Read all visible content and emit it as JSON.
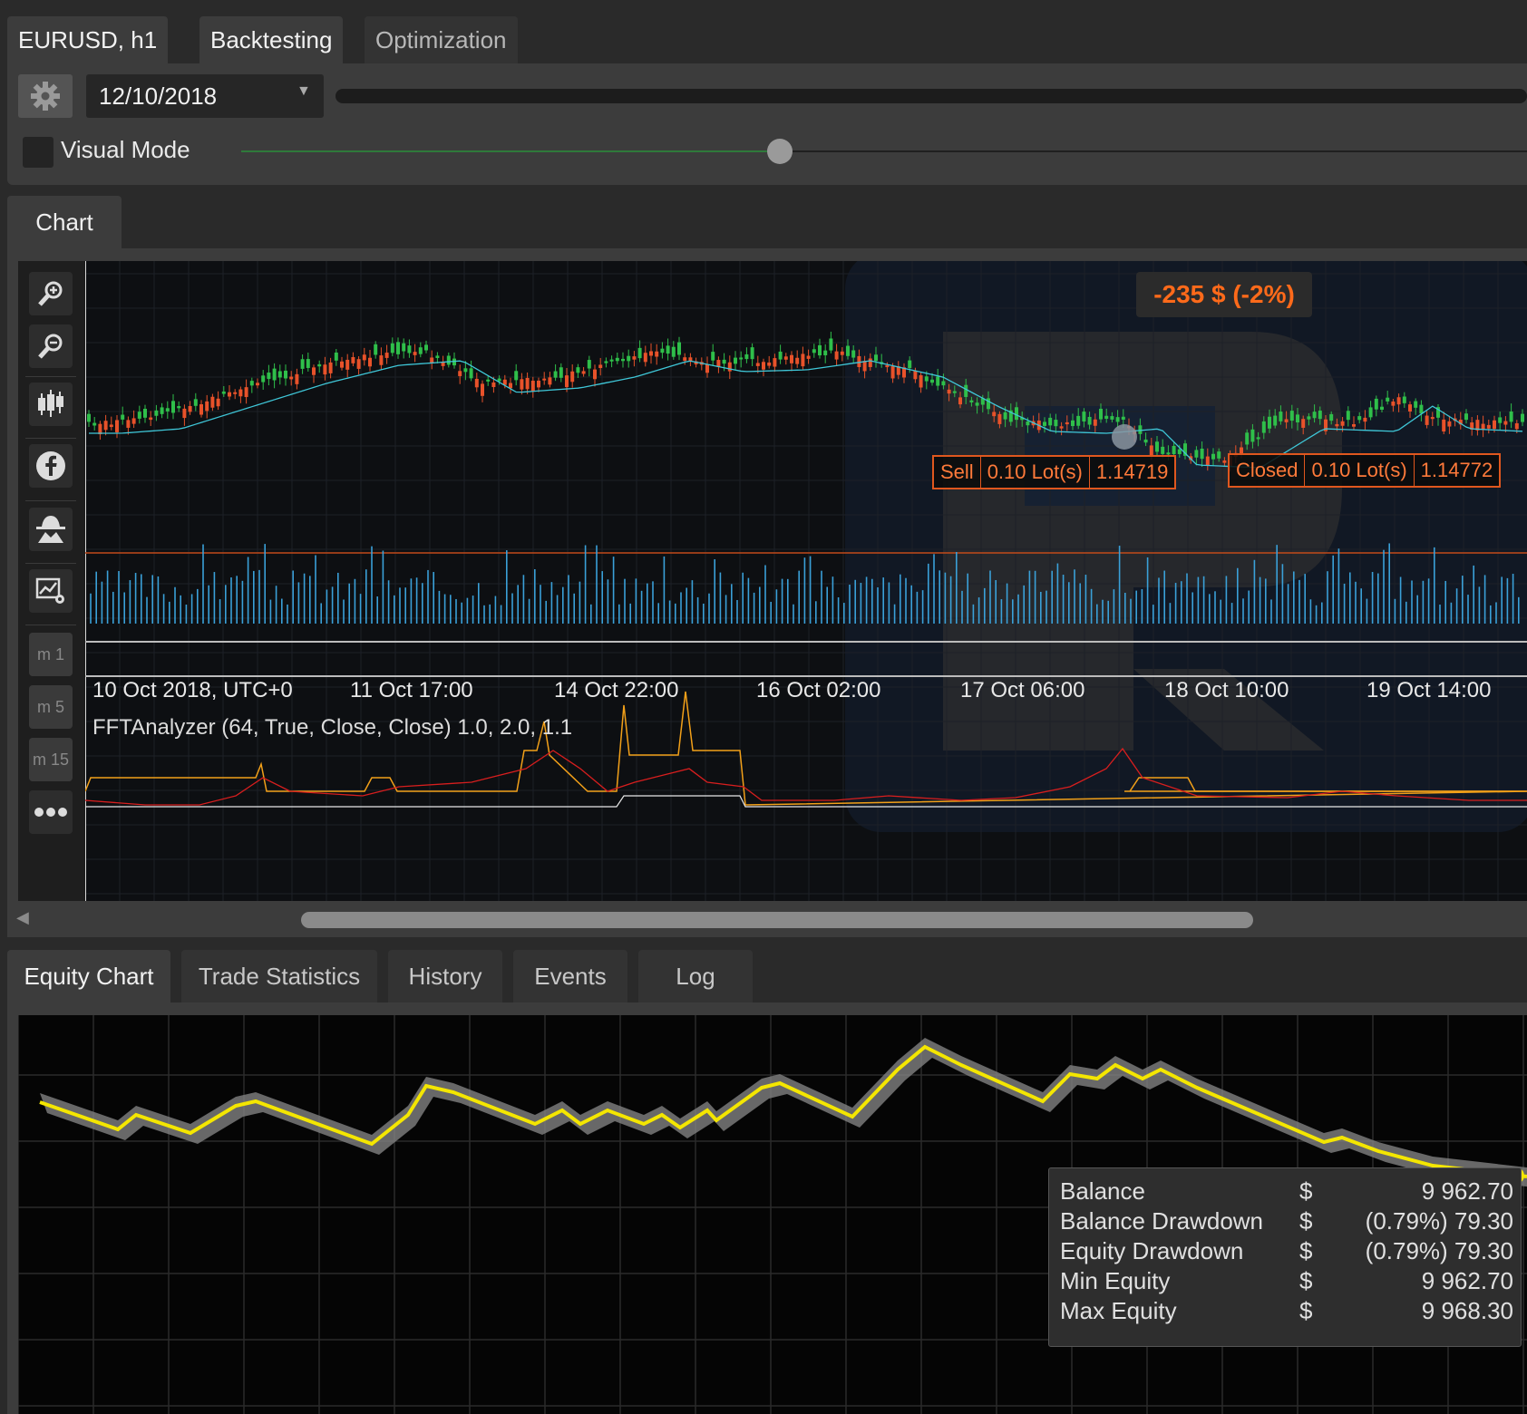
{
  "top_tabs": [
    {
      "label": "EURUSD, h1"
    },
    {
      "label": "Backtesting"
    },
    {
      "label": "Optimization"
    }
  ],
  "backtest": {
    "date": "12/10/2018",
    "visual_mode_label": "Visual Mode",
    "visual_mode_checked": false,
    "speed_slider_position": 0.39
  },
  "chart_tab": "Chart",
  "chart": {
    "pnl": "-235 $ (-2%)",
    "sell_trade": {
      "side": "Sell",
      "lots": "0.10 Lot(s)",
      "price": "1.14719"
    },
    "closed_trade": {
      "side": "Closed",
      "lots": "0.10 Lot(s)",
      "price": "1.14772"
    },
    "time_labels": [
      "10 Oct 2018, UTC+0",
      "11 Oct 17:00",
      "14 Oct 22:00",
      "16 Oct 02:00",
      "17 Oct 06:00",
      "18 Oct 10:00",
      "19 Oct 14:00"
    ],
    "indicator_label": "FFTAnalyzer (64, True, Close, Close) 1.0, 2.0, 1.1",
    "timeframes": [
      "m 1",
      "m 5",
      "m 15"
    ],
    "colors": {
      "up": "#2fbf4a",
      "down": "#e8522a",
      "ma": "#3fc7d8",
      "volume": "#3aa0d8",
      "fft_orange": "#f2a019",
      "fft_red": "#d81e1e"
    }
  },
  "toolbar_icons": [
    "zoom-in-icon",
    "zoom-out-icon",
    "candles-icon",
    "facebook-icon",
    "incognito-icon",
    "chart-settings-icon"
  ],
  "bottom_tabs": [
    {
      "label": "Equity Chart"
    },
    {
      "label": "Trade Statistics"
    },
    {
      "label": "History"
    },
    {
      "label": "Events"
    },
    {
      "label": "Log"
    }
  ],
  "stats": [
    {
      "label": "Balance",
      "currency": "$",
      "value": "9 962.70"
    },
    {
      "label": "Balance Drawdown",
      "currency": "$",
      "value": "(0.79%) 79.30"
    },
    {
      "label": "Equity Drawdown",
      "currency": "$",
      "value": "(0.79%) 79.30"
    },
    {
      "label": "Min Equity",
      "currency": "$",
      "value": "9 962.70"
    },
    {
      "label": "Max Equity",
      "currency": "$",
      "value": "9 968.30"
    }
  ],
  "equity_colors": {
    "balance": "#f4e600",
    "equity_band": "#8a8a8a"
  }
}
